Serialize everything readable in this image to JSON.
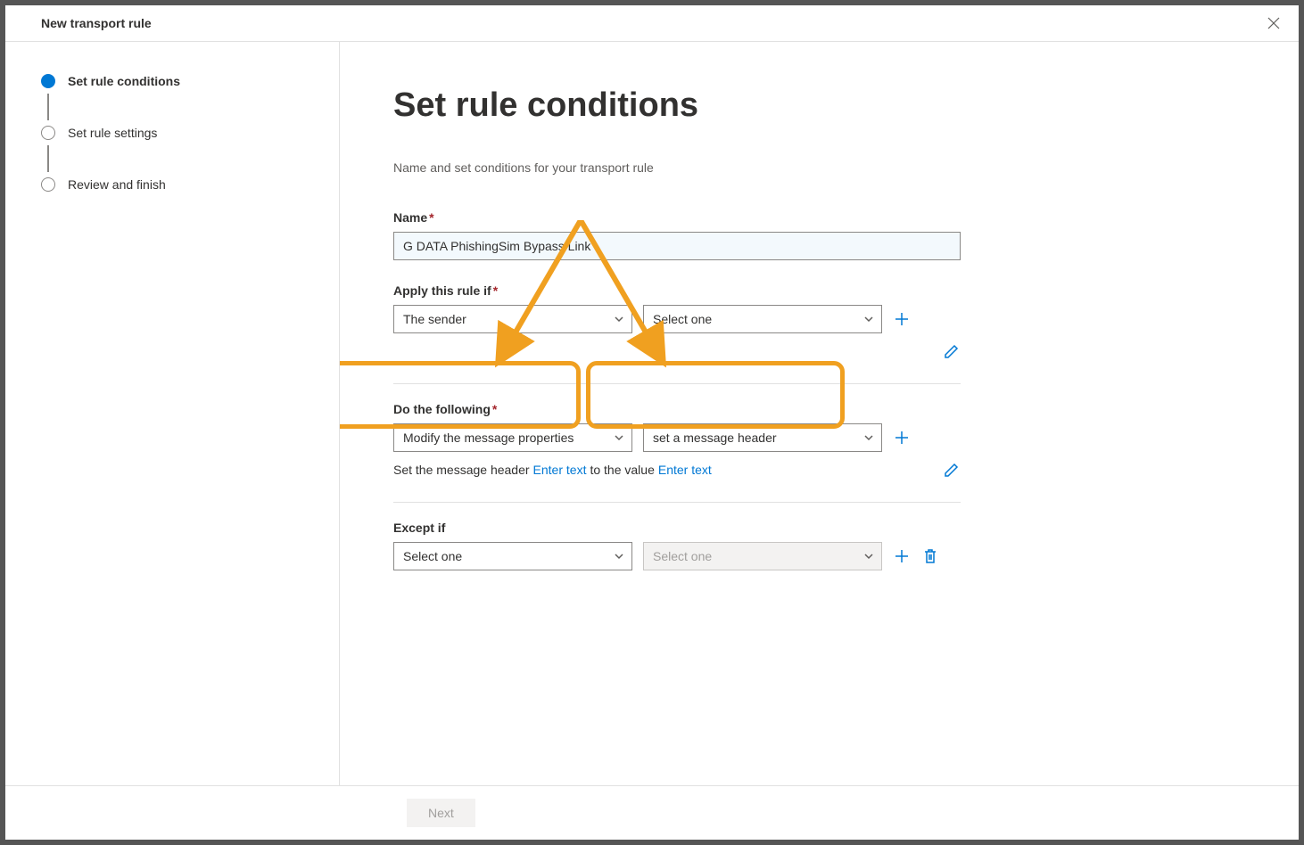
{
  "titlebar": {
    "title": "New transport rule"
  },
  "sidebar": {
    "steps": [
      {
        "label": "Set rule conditions"
      },
      {
        "label": "Set rule settings"
      },
      {
        "label": "Review and finish"
      }
    ]
  },
  "main": {
    "heading": "Set rule conditions",
    "subtitle": "Name and set conditions for your transport rule",
    "name_label": "Name",
    "name_value": "G DATA PhishingSim Bypass Link",
    "apply_label": "Apply this rule if",
    "apply_select1": "The sender",
    "apply_select2_placeholder": "Select one",
    "do_label": "Do the following",
    "do_select1": "Modify the message properties",
    "do_select2": "set a message header",
    "header_text1": "Set the message header",
    "header_link1": "Enter text",
    "header_text2": "to the value",
    "header_link2": "Enter text",
    "except_label": "Except if",
    "except_select1_placeholder": "Select one",
    "except_select2_placeholder": "Select one"
  },
  "footer": {
    "next": "Next"
  }
}
